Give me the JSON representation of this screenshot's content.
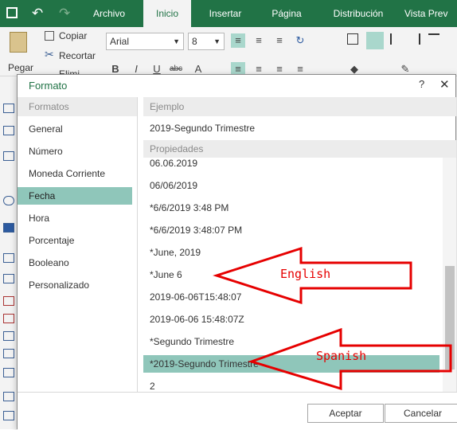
{
  "ribbon": {
    "tabs": [
      {
        "label": "Archivo",
        "active": false
      },
      {
        "label": "Inicio",
        "active": true
      },
      {
        "label": "Insertar",
        "active": false
      },
      {
        "label": "Página",
        "active": false
      },
      {
        "label": "Distribución",
        "active": false
      },
      {
        "label": "Vista Prev",
        "active": false
      }
    ],
    "paste_label": "Pegar",
    "copy_label": "Copiar",
    "cut_label": "Recortar",
    "partial_label": "Elimi",
    "font_name": "Arial",
    "font_size": "8"
  },
  "dialog": {
    "title": "Formato",
    "help_glyph": "?",
    "close_glyph": "✕",
    "formats_header": "Formatos",
    "categories": [
      {
        "label": "General",
        "selected": false
      },
      {
        "label": "Número",
        "selected": false
      },
      {
        "label": "Moneda Corriente",
        "selected": false
      },
      {
        "label": "Fecha",
        "selected": true
      },
      {
        "label": "Hora",
        "selected": false
      },
      {
        "label": "Porcentaje",
        "selected": false
      },
      {
        "label": "Booleano",
        "selected": false
      },
      {
        "label": "Personalizado",
        "selected": false
      }
    ],
    "example_header": "Ejemplo",
    "example_value": "2019-Segundo Trimestre",
    "properties_header": "Propiedades",
    "properties": [
      {
        "label": "06.06.2019",
        "selected": false
      },
      {
        "label": "06/06/2019",
        "selected": false
      },
      {
        "label": "*6/6/2019 3:48 PM",
        "selected": false
      },
      {
        "label": "*6/6/2019 3:48:07 PM",
        "selected": false
      },
      {
        "label": "*June, 2019",
        "selected": false
      },
      {
        "label": "*June 6",
        "selected": false
      },
      {
        "label": "2019-06-06T15:48:07",
        "selected": false
      },
      {
        "label": "2019-06-06 15:48:07Z",
        "selected": false
      },
      {
        "label": "*Segundo Trimestre",
        "selected": false
      },
      {
        "label": "*2019-Segundo Trimestre",
        "selected": true
      },
      {
        "label": "2",
        "selected": false
      }
    ],
    "accept_label": "Aceptar",
    "cancel_label": "Cancelar"
  },
  "annotations": {
    "english_label": "English",
    "spanish_label": "Spanish",
    "arrow_color": "#e60000"
  },
  "colors": {
    "ribbon_green": "#217346",
    "selection": "#8fc6ba"
  }
}
